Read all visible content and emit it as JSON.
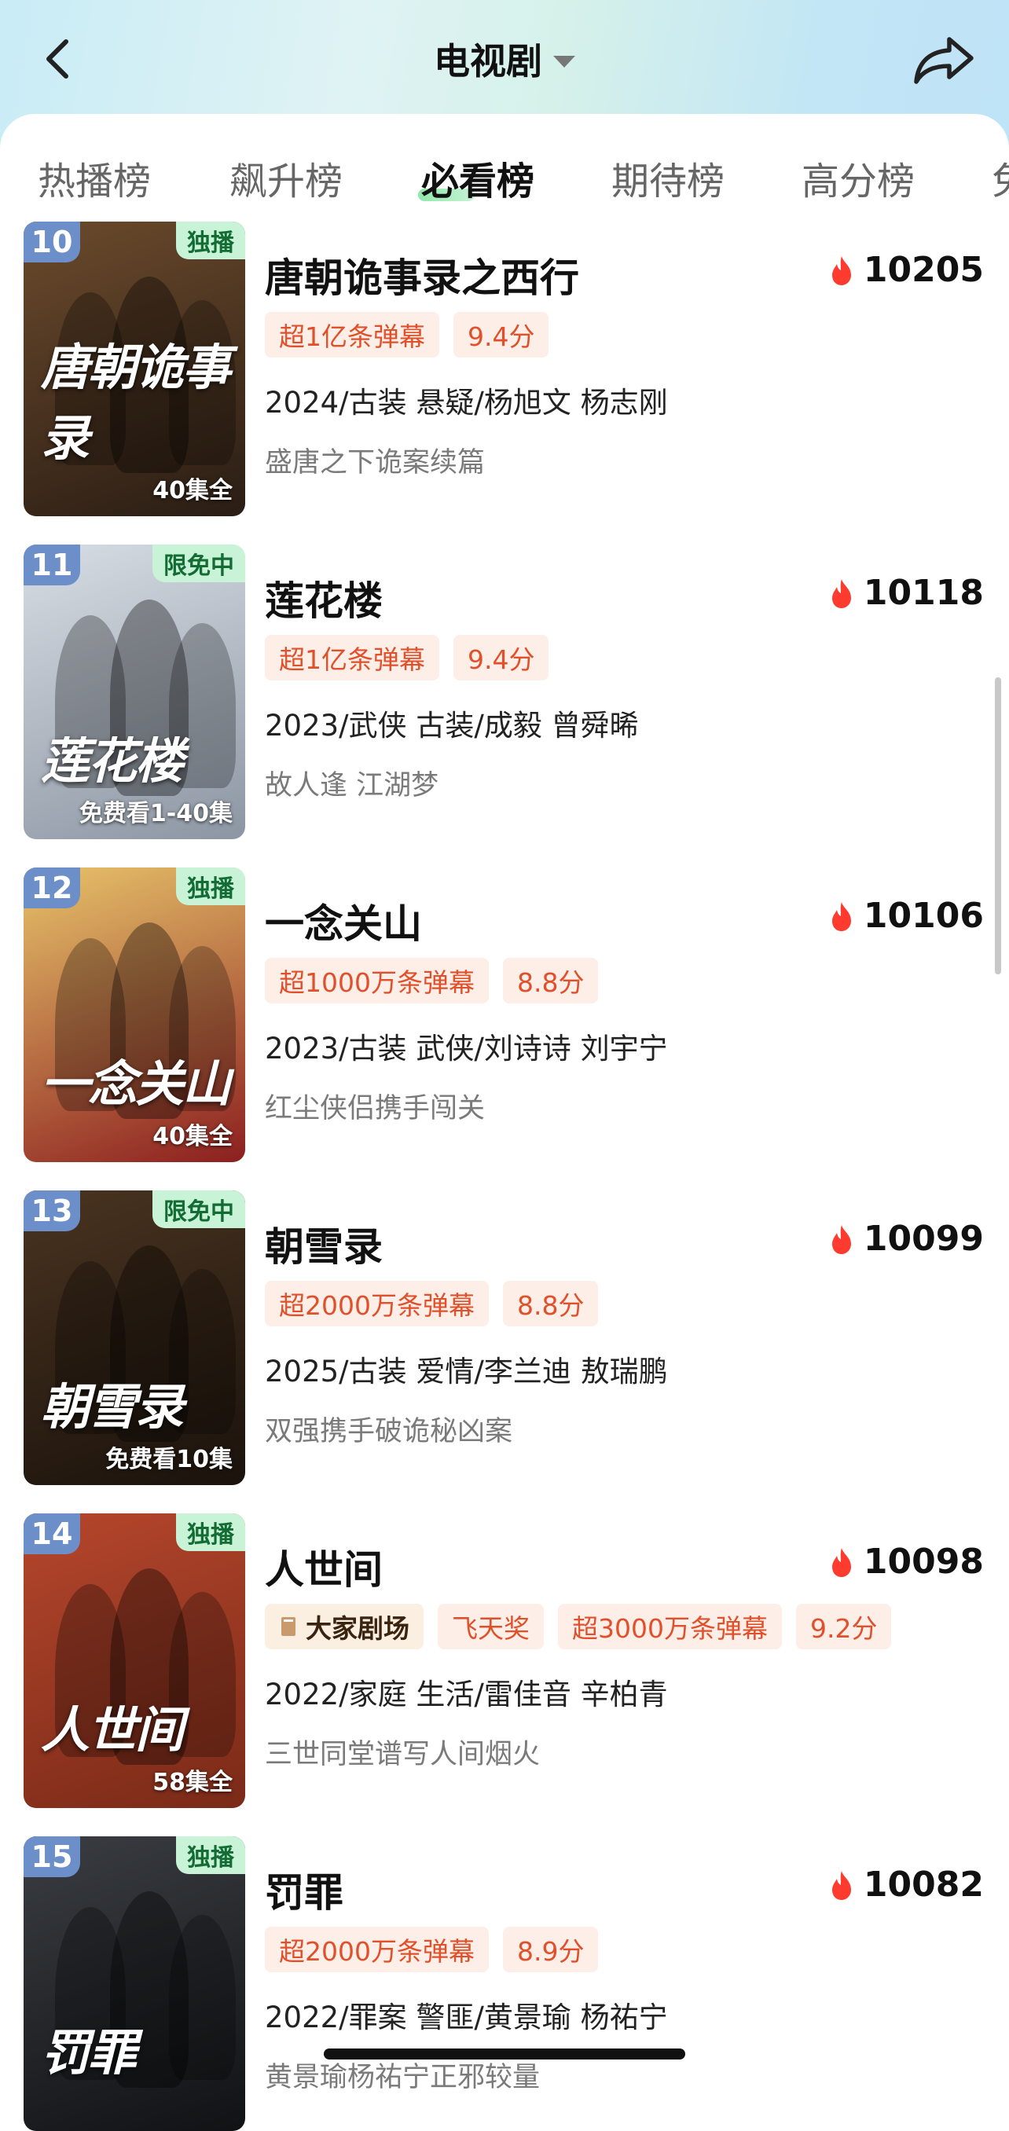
{
  "header": {
    "title": "电视剧"
  },
  "tabs": [
    {
      "label": "热播榜",
      "active": false
    },
    {
      "label": "飙升榜",
      "active": false
    },
    {
      "label": "必看榜",
      "active": true
    },
    {
      "label": "期待榜",
      "active": false
    },
    {
      "label": "高分榜",
      "active": false
    },
    {
      "label": "免",
      "active": false
    }
  ],
  "items": [
    {
      "rank": "10",
      "badge": "独播",
      "poster_footer": "40集全",
      "poster_art": "唐朝诡事录",
      "name": "唐朝诡事录之西行",
      "heat": "10205",
      "tags": [
        "超1亿条弹幕",
        "9.4分"
      ],
      "meta": "2024/古装 悬疑/杨旭文 杨志刚",
      "desc": "盛唐之下诡案续篇",
      "poster_colors": [
        "#6b4a2c",
        "#2a1d14"
      ]
    },
    {
      "rank": "11",
      "badge": "限免中",
      "poster_footer": "免费看1-40集",
      "poster_art": "莲花楼",
      "name": "莲花楼",
      "heat": "10118",
      "tags": [
        "超1亿条弹幕",
        "9.4分"
      ],
      "meta": "2023/武侠 古装/成毅 曾舜晞",
      "desc": "故人逢 江湖梦",
      "poster_colors": [
        "#d8dde4",
        "#8c96a3"
      ]
    },
    {
      "rank": "12",
      "badge": "独播",
      "poster_footer": "40集全",
      "poster_art": "一念关山",
      "name": "一念关山",
      "heat": "10106",
      "tags": [
        "超1000万条弹幕",
        "8.8分"
      ],
      "meta": "2023/古装 武侠/刘诗诗 刘宇宁",
      "desc": "红尘侠侣携手闯关",
      "poster_colors": [
        "#e7c36a",
        "#8c1f1f"
      ]
    },
    {
      "rank": "13",
      "badge": "限免中",
      "poster_footer": "免费看10集",
      "poster_art": "朝雪录",
      "name": "朝雪录",
      "heat": "10099",
      "tags": [
        "超2000万条弹幕",
        "8.8分"
      ],
      "meta": "2025/古装 爱情/李兰迪 敖瑞鹏",
      "desc": "双强携手破诡秘凶案",
      "poster_colors": [
        "#4a3420",
        "#1a120c"
      ]
    },
    {
      "rank": "14",
      "badge": "独播",
      "poster_footer": "58集全",
      "poster_art": "人世间",
      "name": "人世间",
      "heat": "10098",
      "studio_tag": "大家剧场",
      "tags": [
        "飞天奖",
        "超3000万条弹幕",
        "9.2分"
      ],
      "meta": "2022/家庭 生活/雷佳音 辛柏青",
      "desc": "三世同堂谱写人间烟火",
      "poster_colors": [
        "#b5462c",
        "#7a2a18"
      ]
    },
    {
      "rank": "15",
      "badge": "独播",
      "poster_footer": "",
      "poster_art": "罚罪",
      "name": "罚罪",
      "heat": "10082",
      "tags": [
        "超2000万条弹幕",
        "8.9分"
      ],
      "meta": "2022/罪案 警匪/黄景瑜 杨祐宁",
      "desc": "黄景瑜杨祐宁正邪较量",
      "poster_colors": [
        "#3a3d42",
        "#101214"
      ]
    }
  ]
}
